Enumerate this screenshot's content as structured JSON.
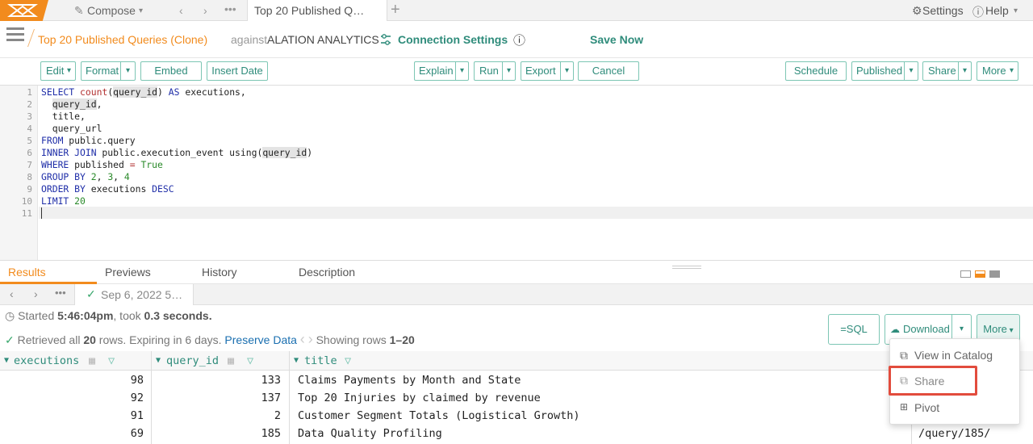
{
  "topbar": {
    "compose_label": "Compose",
    "tab_title": "Top 20 Published Q…",
    "settings_label": "Settings",
    "help_label": "Help"
  },
  "query_header": {
    "query_name": "Top 20 Published Queries (Clone)",
    "against_label": "against",
    "datasource": "ALATION ANALYTICS",
    "connection_settings": "Connection Settings",
    "save_now": "Save Now"
  },
  "toolbar": {
    "edit": "Edit",
    "format": "Format",
    "embed": "Embed",
    "insert_date": "Insert Date",
    "explain": "Explain",
    "run": "Run",
    "export": "Export",
    "cancel": "Cancel",
    "schedule": "Schedule",
    "published": "Published",
    "share": "Share",
    "more": "More"
  },
  "editor": {
    "line_numbers": [
      "1",
      "2",
      "3",
      "4",
      "5",
      "6",
      "7",
      "8",
      "9",
      "10",
      "11"
    ]
  },
  "results_tabs": {
    "results": "Results",
    "previews": "Previews",
    "history": "History",
    "description": "Description"
  },
  "result_tab": {
    "label": "Sep 6, 2022 5…"
  },
  "status": {
    "started_prefix": "Started ",
    "started_time": "5:46:04pm",
    "took_text": ", took ",
    "duration": "0.3 seconds.",
    "retrieved_prefix": "Retrieved all ",
    "row_count": "20",
    "retrieved_suffix": " rows. Expiring in 6 days.",
    "preserve_data": "Preserve Data",
    "showing_prefix": "Showing rows ",
    "showing_range": "1–20"
  },
  "result_buttons": {
    "sql": "=SQL",
    "download": "Download",
    "more": "More"
  },
  "table": {
    "columns": [
      "executions",
      "query_id",
      "title"
    ],
    "rows": [
      {
        "executions": "98",
        "query_id": "133",
        "title": "Claims Payments by Month and State"
      },
      {
        "executions": "92",
        "query_id": "137",
        "title": "Top 20 Injuries by claimed by revenue"
      },
      {
        "executions": "91",
        "query_id": "2",
        "title": "Customer Segment Totals (Logistical Growth)"
      },
      {
        "executions": "69",
        "query_id": "185",
        "title": "Data Quality Profiling"
      }
    ],
    "url_cell": "/query/185/"
  },
  "more_menu": {
    "items": [
      "View in Catalog",
      "Share",
      "Pivot"
    ]
  },
  "colors": {
    "brand_orange": "#f28b1d",
    "teal": "#2f8c7b",
    "highlight_red": "#e24c3d"
  }
}
